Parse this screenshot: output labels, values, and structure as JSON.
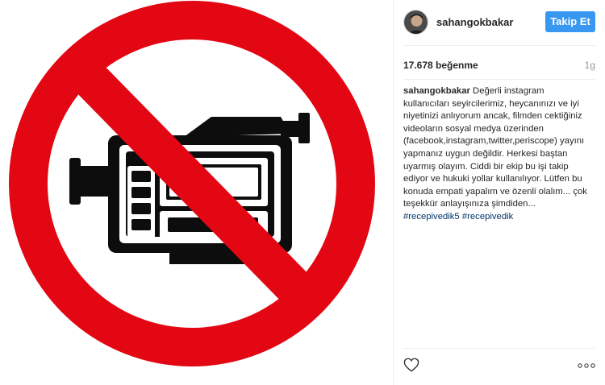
{
  "post": {
    "image_description_icon": "no-video-recording-sign-icon"
  },
  "header": {
    "username": "sahangokbakar",
    "follow_label": "Takip Et"
  },
  "stats": {
    "likes": "17.678 beğenme",
    "age": "1g"
  },
  "caption": {
    "username": "sahangokbakar",
    "text": "Değerli instagram kullanıcıları seyircilerimiz, heycanınızı ve iyi niyetinizi anlıyorum ancak, filmden cektiğiniz videoların sosyal medya üzerinden (facebook,instagram,twitter,periscope) yayını yapmanız uygun değildir. Herkesi baştan uyarmış olayım. Ciddi bir ekip bu işi takip ediyor ve hukuki yollar kullanılıyor. Lütfen bu konuda empati yapalım ve özenli olalım... çok teşekkür anlayışınıza şimdiden...",
    "hashtags": [
      "#recepivedik5",
      "#recepivedik"
    ]
  },
  "actions": {
    "like_icon": "heart-icon",
    "more_icon": "more-options-icon"
  },
  "colors": {
    "sign_red": "#e30613",
    "follow_blue": "#3897f0",
    "hashtag": "#003569"
  }
}
